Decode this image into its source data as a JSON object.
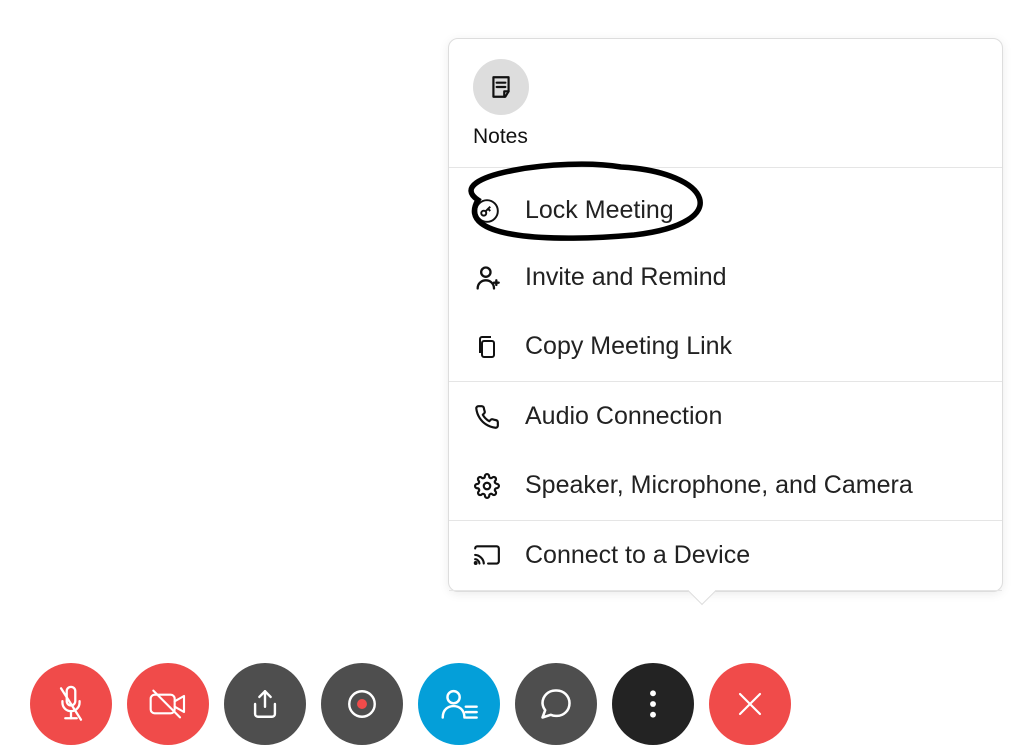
{
  "popup": {
    "notes_label": "Notes",
    "items_group1": [
      {
        "id": "lock-meeting",
        "icon": "key-icon",
        "label": "Lock Meeting"
      },
      {
        "id": "invite-remind",
        "icon": "person-plus-icon",
        "label": "Invite and Remind"
      },
      {
        "id": "copy-link",
        "icon": "copy-icon",
        "label": "Copy Meeting Link"
      }
    ],
    "items_group2": [
      {
        "id": "audio-connection",
        "icon": "phone-icon",
        "label": "Audio Connection"
      },
      {
        "id": "speaker-mic-camera",
        "icon": "gear-icon",
        "label": "Speaker, Microphone, and Camera"
      }
    ],
    "items_group3": [
      {
        "id": "connect-device",
        "icon": "cast-icon",
        "label": "Connect to a Device"
      }
    ]
  },
  "toolbar": {
    "buttons": [
      {
        "id": "mute",
        "icon": "mic-off-icon",
        "color": "red"
      },
      {
        "id": "stop-video",
        "icon": "camera-off-icon",
        "color": "red"
      },
      {
        "id": "share",
        "icon": "share-icon",
        "color": "gray"
      },
      {
        "id": "record",
        "icon": "record-icon",
        "color": "gray"
      },
      {
        "id": "participants",
        "icon": "participants-icon",
        "color": "blue"
      },
      {
        "id": "chat",
        "icon": "chat-icon",
        "color": "gray"
      },
      {
        "id": "more",
        "icon": "more-icon",
        "color": "dark"
      },
      {
        "id": "leave",
        "icon": "close-icon",
        "color": "red"
      }
    ]
  }
}
